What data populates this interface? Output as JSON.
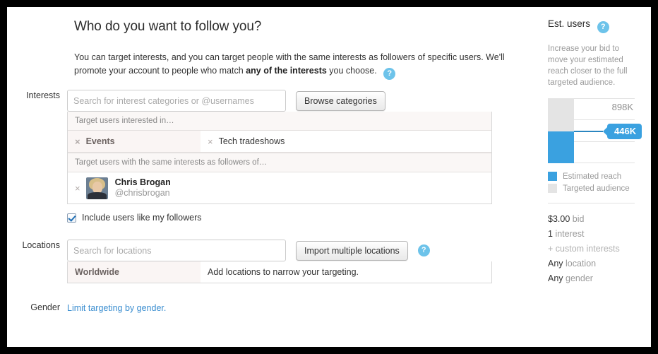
{
  "page": {
    "title": "Who do you want to follow you?",
    "intro_before": "You can target interests, and you can target people with the same interests as followers of specific users. We'll promote your account to people who match ",
    "intro_bold": "any of the interests",
    "intro_after": " you choose.",
    "help_glyph": "?"
  },
  "interests": {
    "label": "Interests",
    "search_placeholder": "Search for interest categories or @usernames",
    "search_value": "",
    "browse_button": "Browse categories",
    "caption_interested": "Target users interested in…",
    "caption_followers": "Target users with the same interests as followers of…",
    "remove_glyph": "×",
    "chips": [
      {
        "left": "Events",
        "right": "Tech tradeshows"
      }
    ],
    "user": {
      "name": "Chris Brogan",
      "handle": "@chrisbrogan"
    },
    "include_followers_label": "Include users like my followers",
    "include_followers_checked": true
  },
  "locations": {
    "label": "Locations",
    "search_placeholder": "Search for locations",
    "search_value": "",
    "import_button": "Import multiple locations",
    "scope": "Worldwide",
    "hint": "Add locations to narrow your targeting."
  },
  "gender": {
    "label": "Gender",
    "link": "Limit targeting by gender."
  },
  "sidebar": {
    "title": "Est. users",
    "help_glyph": "?",
    "description": "Increase your bid to move your estimated reach closer to the full targeted audience.",
    "legend": [
      {
        "label": "Estimated reach",
        "color": "#3aa1e0"
      },
      {
        "label": "Targeted audience",
        "color": "#e4e4e4"
      }
    ],
    "stats": [
      {
        "value": "$3.00",
        "label": "bid",
        "muted": false
      },
      {
        "value": "1",
        "label": "interest",
        "muted": false
      },
      {
        "value": "",
        "label": "+ custom interests",
        "muted": true
      },
      {
        "value": "Any",
        "label": "location",
        "muted": false
      },
      {
        "value": "Any",
        "label": "gender",
        "muted": false
      }
    ]
  },
  "chart_data": {
    "type": "bar",
    "title": "Est. users",
    "categories": [
      "Audience"
    ],
    "series": [
      {
        "name": "Targeted audience",
        "values": [
          898000
        ],
        "label": "898K",
        "color": "#e4e4e4"
      },
      {
        "name": "Estimated reach",
        "values": [
          446000
        ],
        "label": "446K",
        "color": "#3aa1e0"
      }
    ],
    "ylim": [
      0,
      898000
    ],
    "gridlines": 4,
    "xlabel": "",
    "ylabel": "",
    "legend_position": "bottom",
    "annotations": [
      {
        "text": "446K",
        "value": 446000,
        "style": "callout-pointer"
      },
      {
        "text": "898K",
        "value": 898000,
        "style": "plain"
      }
    ]
  }
}
